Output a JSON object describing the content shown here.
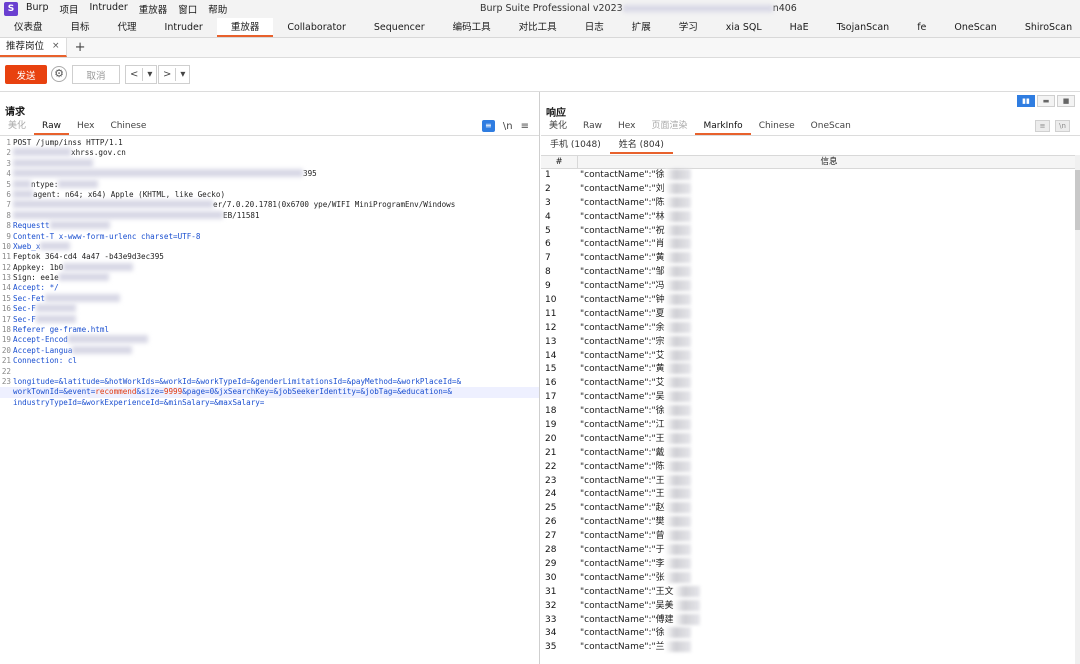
{
  "app": {
    "logo": "S",
    "title": "Burp Suite Professional v2023",
    "title_suffix": "n406",
    "menu": [
      "Burp",
      "项目",
      "Intruder",
      "重放器",
      "窗口",
      "帮助"
    ]
  },
  "main_tabs": [
    "仪表盘",
    "目标",
    "代理",
    "Intruder",
    "重放器",
    "Collaborator",
    "Sequencer",
    "编码工具",
    "对比工具",
    "日志",
    "扩展",
    "学习",
    "xia SQL",
    "HaE",
    "TsojanScan",
    "fe",
    "OneScan",
    "ShiroScan"
  ],
  "active_main_tab": "重放器",
  "sub_tab": {
    "label": "推荐岗位",
    "close": "×",
    "add": "+"
  },
  "toolbar": {
    "send": "发送",
    "cancel": "取消",
    "back": "<",
    "forward": ">",
    "dropdown": "▾",
    "gear": "⚙"
  },
  "request": {
    "title": "请求",
    "tabs": [
      "美化",
      "Raw",
      "Hex",
      "Chinese"
    ],
    "active_tab": "Raw",
    "icons": {
      "wrap": "≡",
      "newline": "\\n",
      "menu": "≡"
    },
    "lines": [
      {
        "n": "1",
        "text": "POST /jump/inss HTTP/1.1"
      },
      {
        "n": "2",
        "text": "xhrss.gov.cn"
      },
      {
        "n": "3",
        "text": ""
      },
      {
        "n": "4",
        "text": "395"
      },
      {
        "n": "5",
        "text": "ntype:"
      },
      {
        "n": "6",
        "text": "agent:  n64; x64) Apple  (KHTML, like Gecko)"
      },
      {
        "n": "7",
        "text": "er/7.0.20.1781(0x6700  ype/WIFI MiniProgramEnv/Windows"
      },
      {
        "n": "8",
        "text": "EB/11581"
      },
      {
        "n": "8",
        "text": "Requestt"
      },
      {
        "n": "9",
        "text": "Content-T  x-www-form-urlenc  charset=UTF-8"
      },
      {
        "n": "10",
        "text": "Xweb_x"
      },
      {
        "n": "11",
        "text": "Feptok  364-cd4  4a47  -b43e9d3ec395"
      },
      {
        "n": "12",
        "text": "Appkey: 1b0"
      },
      {
        "n": "13",
        "text": "Sign: ee1e"
      },
      {
        "n": "14",
        "text": "Accept: */"
      },
      {
        "n": "15",
        "text": "Sec-Fet"
      },
      {
        "n": "16",
        "text": "Sec-F"
      },
      {
        "n": "17",
        "text": "Sec-F"
      },
      {
        "n": "18",
        "text": "Referer  ge-frame.html"
      },
      {
        "n": "19",
        "text": "Accept-Encod"
      },
      {
        "n": "20",
        "text": "Accept-Langua"
      },
      {
        "n": "21",
        "text": "Connection: cl"
      },
      {
        "n": "22",
        "text": ""
      }
    ],
    "body_line_no": "23",
    "body": {
      "l1": "longitude=&latitude=&hotWorkIds=&workId=&workTypeId=&genderLimitationsId=&payMethod=&workPlaceId=&",
      "l2_pre": "workTownId=&event=",
      "l2_event": "recommend",
      "l2_mid": "&size=",
      "l2_size": "9999",
      "l2_post": "&page=0&jxSearchKey=&jobSeekerIdentity=&jobTag=&education=&",
      "l3": "industryTypeId=&workExperienceId=&minSalary=&maxSalary="
    }
  },
  "response": {
    "title": "响应",
    "tabs": [
      "美化",
      "Raw",
      "Hex",
      "页面渲染",
      "MarkInfo",
      "Chinese",
      "OneScan"
    ],
    "active_tab": "MarkInfo",
    "info_tabs": [
      "手机 (1048)",
      "姓名 (804)"
    ],
    "active_info_tab": "姓名 (804)",
    "columns": [
      "#",
      "信息"
    ],
    "rows": [
      {
        "n": "1",
        "v": "\"contactName\":\"徐"
      },
      {
        "n": "2",
        "v": "\"contactName\":\"刘"
      },
      {
        "n": "3",
        "v": "\"contactName\":\"陈"
      },
      {
        "n": "4",
        "v": "\"contactName\":\"林"
      },
      {
        "n": "5",
        "v": "\"contactName\":\"祝"
      },
      {
        "n": "6",
        "v": "\"contactName\":\"肖"
      },
      {
        "n": "7",
        "v": "\"contactName\":\"黄"
      },
      {
        "n": "8",
        "v": "\"contactName\":\"邹"
      },
      {
        "n": "9",
        "v": "\"contactName\":\"冯"
      },
      {
        "n": "10",
        "v": "\"contactName\":\"钟"
      },
      {
        "n": "11",
        "v": "\"contactName\":\"夏"
      },
      {
        "n": "12",
        "v": "\"contactName\":\"余"
      },
      {
        "n": "13",
        "v": "\"contactName\":\"宗"
      },
      {
        "n": "14",
        "v": "\"contactName\":\"艾"
      },
      {
        "n": "15",
        "v": "\"contactName\":\"黄"
      },
      {
        "n": "16",
        "v": "\"contactName\":\"艾"
      },
      {
        "n": "17",
        "v": "\"contactName\":\"吴"
      },
      {
        "n": "18",
        "v": "\"contactName\":\"徐"
      },
      {
        "n": "19",
        "v": "\"contactName\":\"江"
      },
      {
        "n": "20",
        "v": "\"contactName\":\"王"
      },
      {
        "n": "21",
        "v": "\"contactName\":\"戴"
      },
      {
        "n": "22",
        "v": "\"contactName\":\"陈"
      },
      {
        "n": "23",
        "v": "\"contactName\":\"王"
      },
      {
        "n": "24",
        "v": "\"contactName\":\"王"
      },
      {
        "n": "25",
        "v": "\"contactName\":\"赵"
      },
      {
        "n": "26",
        "v": "\"contactName\":\"樊"
      },
      {
        "n": "27",
        "v": "\"contactName\":\"曾"
      },
      {
        "n": "28",
        "v": "\"contactName\":\"于"
      },
      {
        "n": "29",
        "v": "\"contactName\":\"李"
      },
      {
        "n": "30",
        "v": "\"contactName\":\"张"
      },
      {
        "n": "31",
        "v": "\"contactName\":\"王文"
      },
      {
        "n": "32",
        "v": "\"contactName\":\"吴美"
      },
      {
        "n": "33",
        "v": "\"contactName\":\"傅建"
      },
      {
        "n": "34",
        "v": "\"contactName\":\"徐"
      },
      {
        "n": "35",
        "v": "\"contactName\":\"兰"
      }
    ]
  },
  "colors": {
    "accent": "#e8612c",
    "send": "#e8410f",
    "blue": "#2f7de1",
    "key_blue": "#1a4fd0",
    "value_red": "#e03a12"
  }
}
